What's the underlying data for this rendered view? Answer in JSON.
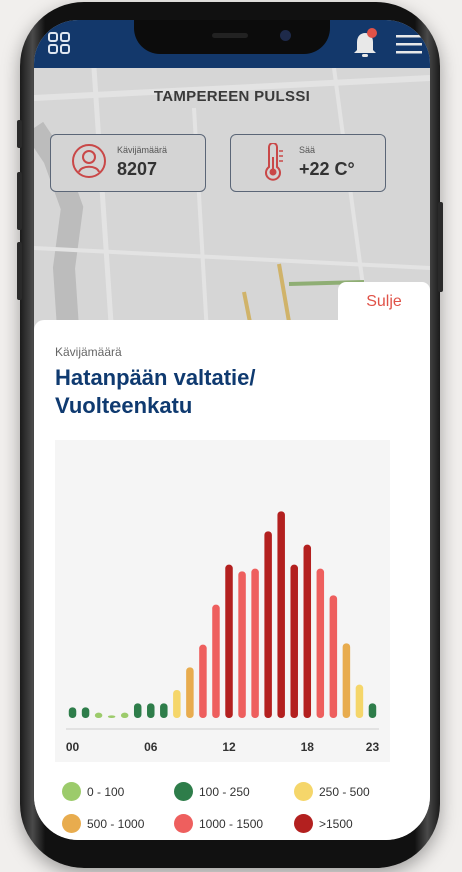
{
  "header": {
    "title": "TAMPEREEN PULSSI"
  },
  "stats": {
    "visitors": {
      "label": "Kävijämäärä",
      "value": "8207"
    },
    "weather": {
      "label": "Sää",
      "value": "+22 C°"
    }
  },
  "sheet": {
    "close_label": "Sulje",
    "subtitle": "Kävijämäärä",
    "title_line1": "Hatanpään valtatie/",
    "title_line2": "Vuolteenkatu"
  },
  "colors": {
    "nav": "#13386b",
    "accent_red": "#e05248",
    "title_blue": "#0f3a70"
  },
  "icons": [
    "grid-icon",
    "bell-icon",
    "menu-icon",
    "person-icon",
    "thermometer-icon"
  ],
  "chart_data": {
    "type": "bar",
    "categories": [
      "00",
      "01",
      "02",
      "03",
      "04",
      "05",
      "06",
      "07",
      "08",
      "09",
      "10",
      "11",
      "12",
      "13",
      "14",
      "15",
      "16",
      "17",
      "18",
      "19",
      "20",
      "21",
      "22",
      "23"
    ],
    "x_tick_labels": [
      "00",
      "06",
      "12",
      "18",
      "23"
    ],
    "values": [
      80,
      80,
      40,
      20,
      40,
      110,
      110,
      110,
      210,
      380,
      550,
      850,
      1150,
      1100,
      1120,
      1400,
      1550,
      1150,
      1300,
      1120,
      920,
      560,
      250,
      110
    ],
    "bar_colors": [
      "#2e7d4a",
      "#2e7d4a",
      "#9ccb6b",
      "#9ccb6b",
      "#9ccb6b",
      "#2e7d4a",
      "#2e7d4a",
      "#2e7d4a",
      "#f5d66a",
      "#e8ac4e",
      "#ee5f5e",
      "#ee5f5e",
      "#b3201f",
      "#ee5f5e",
      "#ee5f5e",
      "#b3201f",
      "#b3201f",
      "#b3201f",
      "#b3201f",
      "#ee5f5e",
      "#ee5f5e",
      "#e8ac4e",
      "#f5d66a",
      "#2e7d4a"
    ],
    "ylim": [
      0,
      1800
    ],
    "legend": [
      {
        "label": "0 - 100",
        "color": "#9ccb6b"
      },
      {
        "label": "100 - 250",
        "color": "#2e7d4a"
      },
      {
        "label": "250 - 500",
        "color": "#f5d66a"
      },
      {
        "label": "500 - 1000",
        "color": "#e8ac4e"
      },
      {
        "label": "1000 - 1500",
        "color": "#ee5f5e"
      },
      {
        "label": ">1500",
        "color": "#b3201f"
      }
    ]
  }
}
